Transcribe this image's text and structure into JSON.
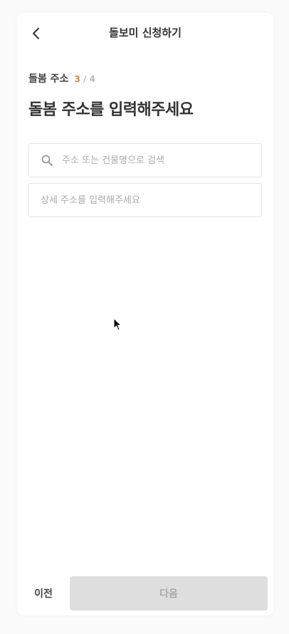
{
  "header": {
    "title": "돌보미 신청하기",
    "back_icon": "chevron-left-icon"
  },
  "step": {
    "label": "돌봄 주소",
    "current": "3",
    "separator": "/",
    "total": "4"
  },
  "main": {
    "title": "돌봄 주소를 입력해주세요",
    "search": {
      "placeholder": "주소 또는 건물명으로 검색",
      "value": "",
      "icon": "search-icon"
    },
    "detail": {
      "placeholder": "상세 주소를 입력해주세요",
      "value": ""
    }
  },
  "footer": {
    "prev_label": "이전",
    "next_label": "다음"
  },
  "colors": {
    "accent": "#e08a4a",
    "disabled_button_bg": "#dedede",
    "disabled_button_text": "#aaaaaa"
  }
}
